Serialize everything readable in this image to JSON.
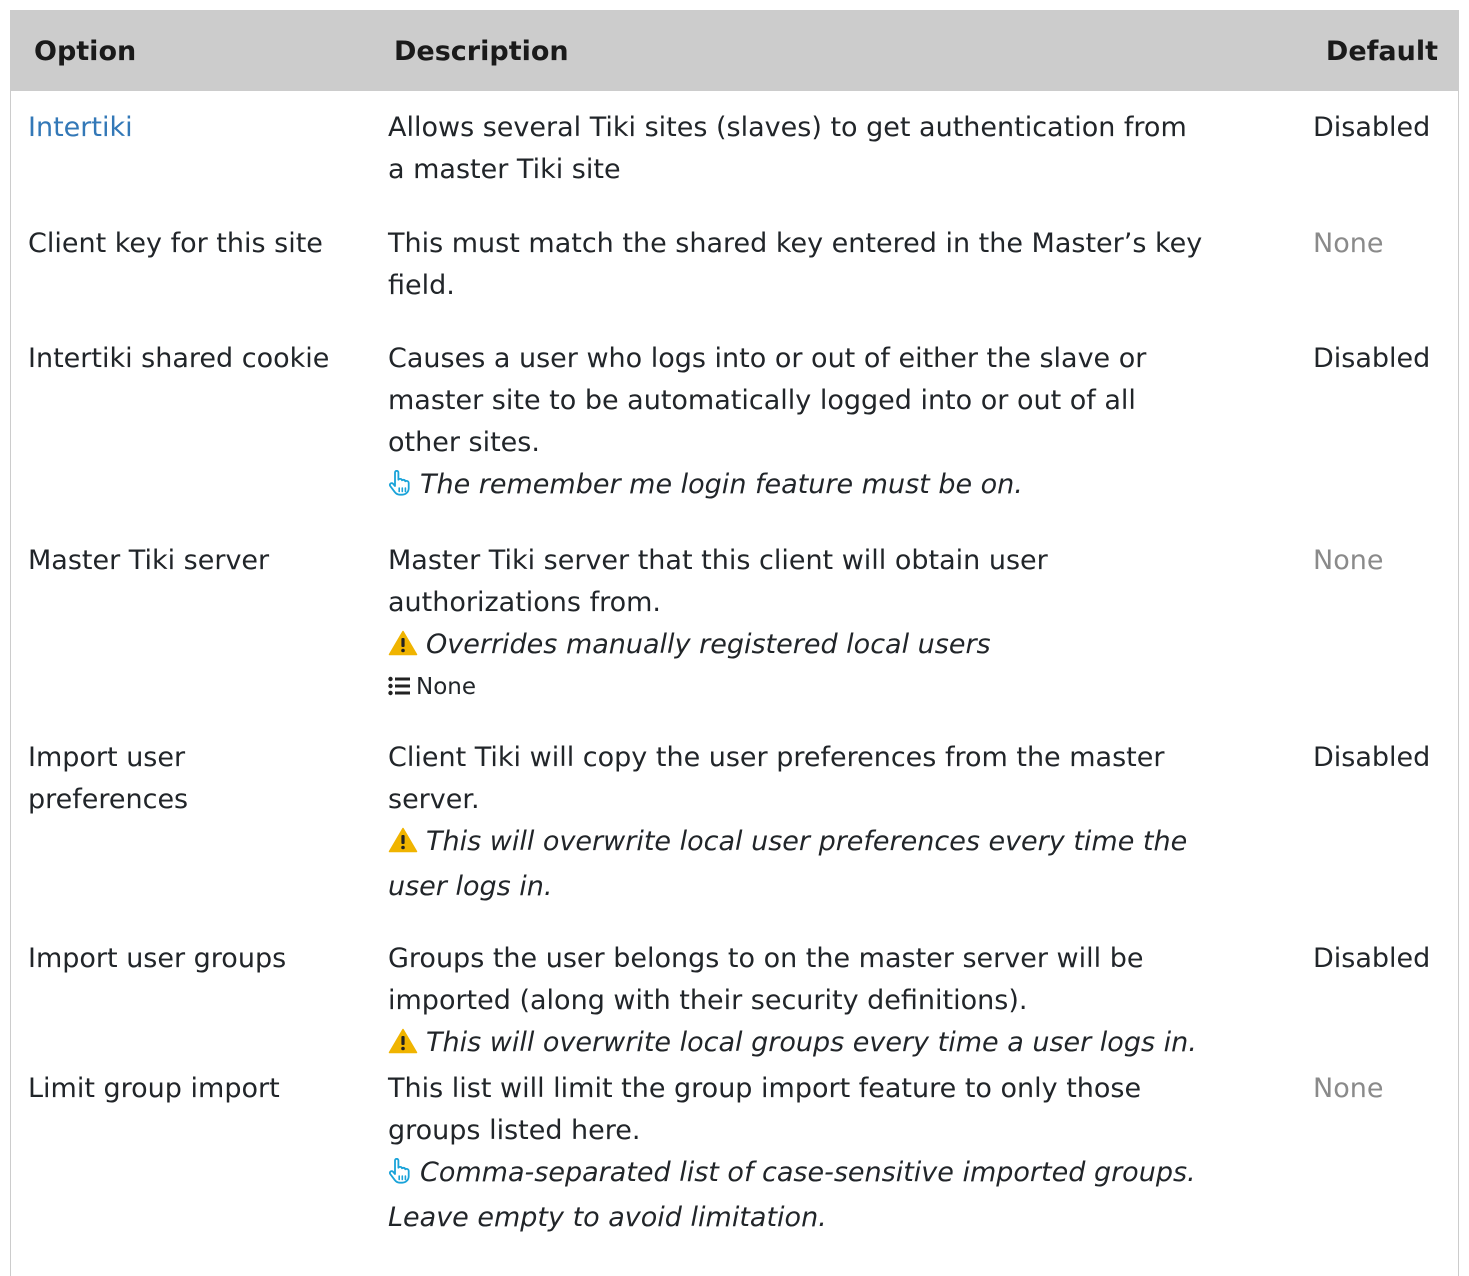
{
  "header": {
    "option": "Option",
    "description": "Description",
    "default": "Default"
  },
  "rows": [
    {
      "option": "Intertiki",
      "description": [
        "Allows several Tiki sites (slaves) to get authentication from",
        "a master Tiki site"
      ],
      "default": "Disabled"
    },
    {
      "option": "Client key for this site",
      "description": [
        "This must match the shared key entered in the Master’s key",
        "field."
      ],
      "default": "None"
    },
    {
      "option": "Intertiki shared cookie",
      "description": [
        "Causes a user who logs into or out of either the slave or",
        "master site to be automatically logged into or out of all",
        "other sites."
      ],
      "note": "The remember me login feature must be on.",
      "note_icon": "pointing-hand-icon",
      "default": "Disabled"
    },
    {
      "option": "Master Tiki server",
      "description": [
        "Master Tiki server that this client will obtain user",
        "authorizations from."
      ],
      "note": "Overrides manually registered local users",
      "note_icon": "warning-icon",
      "options_label": "None",
      "options_icon": "list-icon",
      "default": "None"
    },
    {
      "option": [
        "Import user",
        "preferences"
      ],
      "description": [
        "Client Tiki will copy the user preferences from the master",
        "server."
      ],
      "note": [
        "This will overwrite local user preferences every time the",
        "user logs in."
      ],
      "note_icon": "warning-icon",
      "default": "Disabled"
    },
    {
      "option": "Import user groups",
      "description": [
        "Groups the user belongs to on the master server will be",
        "imported (along with their security definitions)."
      ],
      "note": "This will overwrite local groups every time a user logs in.",
      "note_icon": "warning-icon",
      "default": "Disabled"
    },
    {
      "option": "Limit group import",
      "description": [
        "This list will limit the group import feature to only those",
        "groups listed here."
      ],
      "note": [
        "Comma-separated list of case-sensitive imported groups.",
        "Leave empty to avoid limitation."
      ],
      "note_icon": "pointing-hand-icon",
      "default": "None"
    }
  ],
  "colors": {
    "header_bg": "#cccccc",
    "link": "#3378b7",
    "muted": "#8a8a8a",
    "warning": "#f0b400",
    "hand": "#1aa3d9"
  }
}
